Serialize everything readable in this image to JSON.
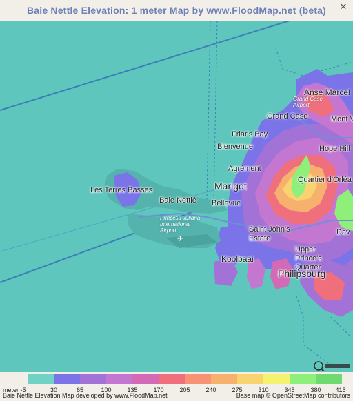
{
  "title": "Baie Nettle Elevation: 1 meter Map by www.FloodMap.net (beta)",
  "close_icon": "close-icon",
  "places": {
    "anse_marcel": "Anse Marcel",
    "grand_case_airport": "Grand Case Airport",
    "grand_case": "Grand Case",
    "mont_v": "Mont V",
    "friars_bay": "Friar's Bay",
    "bienvenue": "Bienvenue",
    "hope_hill": "Hope Hill",
    "agrement": "Agrément",
    "quartier_dorleans": "Quartier d'Orléa",
    "marigot": "Marigot",
    "les_terres_basses": "Les Terres Basses",
    "baie_nettle": "Baie Nettlé",
    "bellevue": "Bellevue",
    "princess_juliana": "Princess Juliana International Airport",
    "saint_johns_estate": "Saint John's Estate",
    "upper_princes_quarter": "Upper Prince's Quarter",
    "koolbaai": "Koolbaai",
    "philipsburg": "Philipsburg",
    "dav": "Dav"
  },
  "legend": {
    "unit_label": "meter",
    "values": [
      "-5",
      "30",
      "65",
      "100",
      "135",
      "170",
      "205",
      "240",
      "275",
      "310",
      "345",
      "380",
      "415"
    ],
    "colors": [
      "#6fd2c4",
      "#7b73e8",
      "#a272d6",
      "#c477d1",
      "#d26ab6",
      "#f06f7d",
      "#f79274",
      "#f7b16f",
      "#f9d36f",
      "#f5f270",
      "#8ef07a",
      "#6fdb6f"
    ]
  },
  "footer": {
    "left": "Baie Nettle Elevation Map developed by www.FloodMap.net",
    "right": "Base map © OpenStreetMap contributors"
  },
  "osm_logo_icon": "openstreetmap-logo-icon"
}
